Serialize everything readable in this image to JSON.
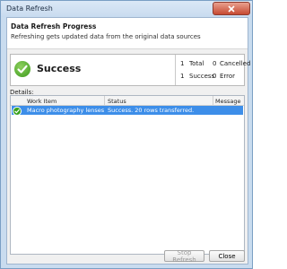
{
  "window": {
    "title": "Data Refresh",
    "close_icon": "close-icon"
  },
  "header": {
    "title": "Data Refresh Progress",
    "subtitle": "Refreshing gets updated data from the original data sources"
  },
  "status": {
    "icon": "success-check-icon",
    "text": "Success",
    "counts": {
      "total_value": "1",
      "total_label": "Total",
      "success_value": "1",
      "success_label": "Success",
      "cancelled_value": "0",
      "cancelled_label": "Cancelled",
      "error_value": "0",
      "error_label": "Error"
    }
  },
  "details": {
    "label": "Details:",
    "columns": [
      "Work Item",
      "Status",
      "Message"
    ],
    "rows": [
      {
        "icon": "success-check-icon",
        "work_item": "Macro photography lenses",
        "status": "Success. 20 rows transferred.",
        "message": ""
      }
    ]
  },
  "buttons": {
    "stop_refresh": "Stop Refresh",
    "close": "Close"
  },
  "colors": {
    "selected_row": "#3d8ee9",
    "success_green": "#3c9a1d",
    "close_button": "#c64a32"
  }
}
